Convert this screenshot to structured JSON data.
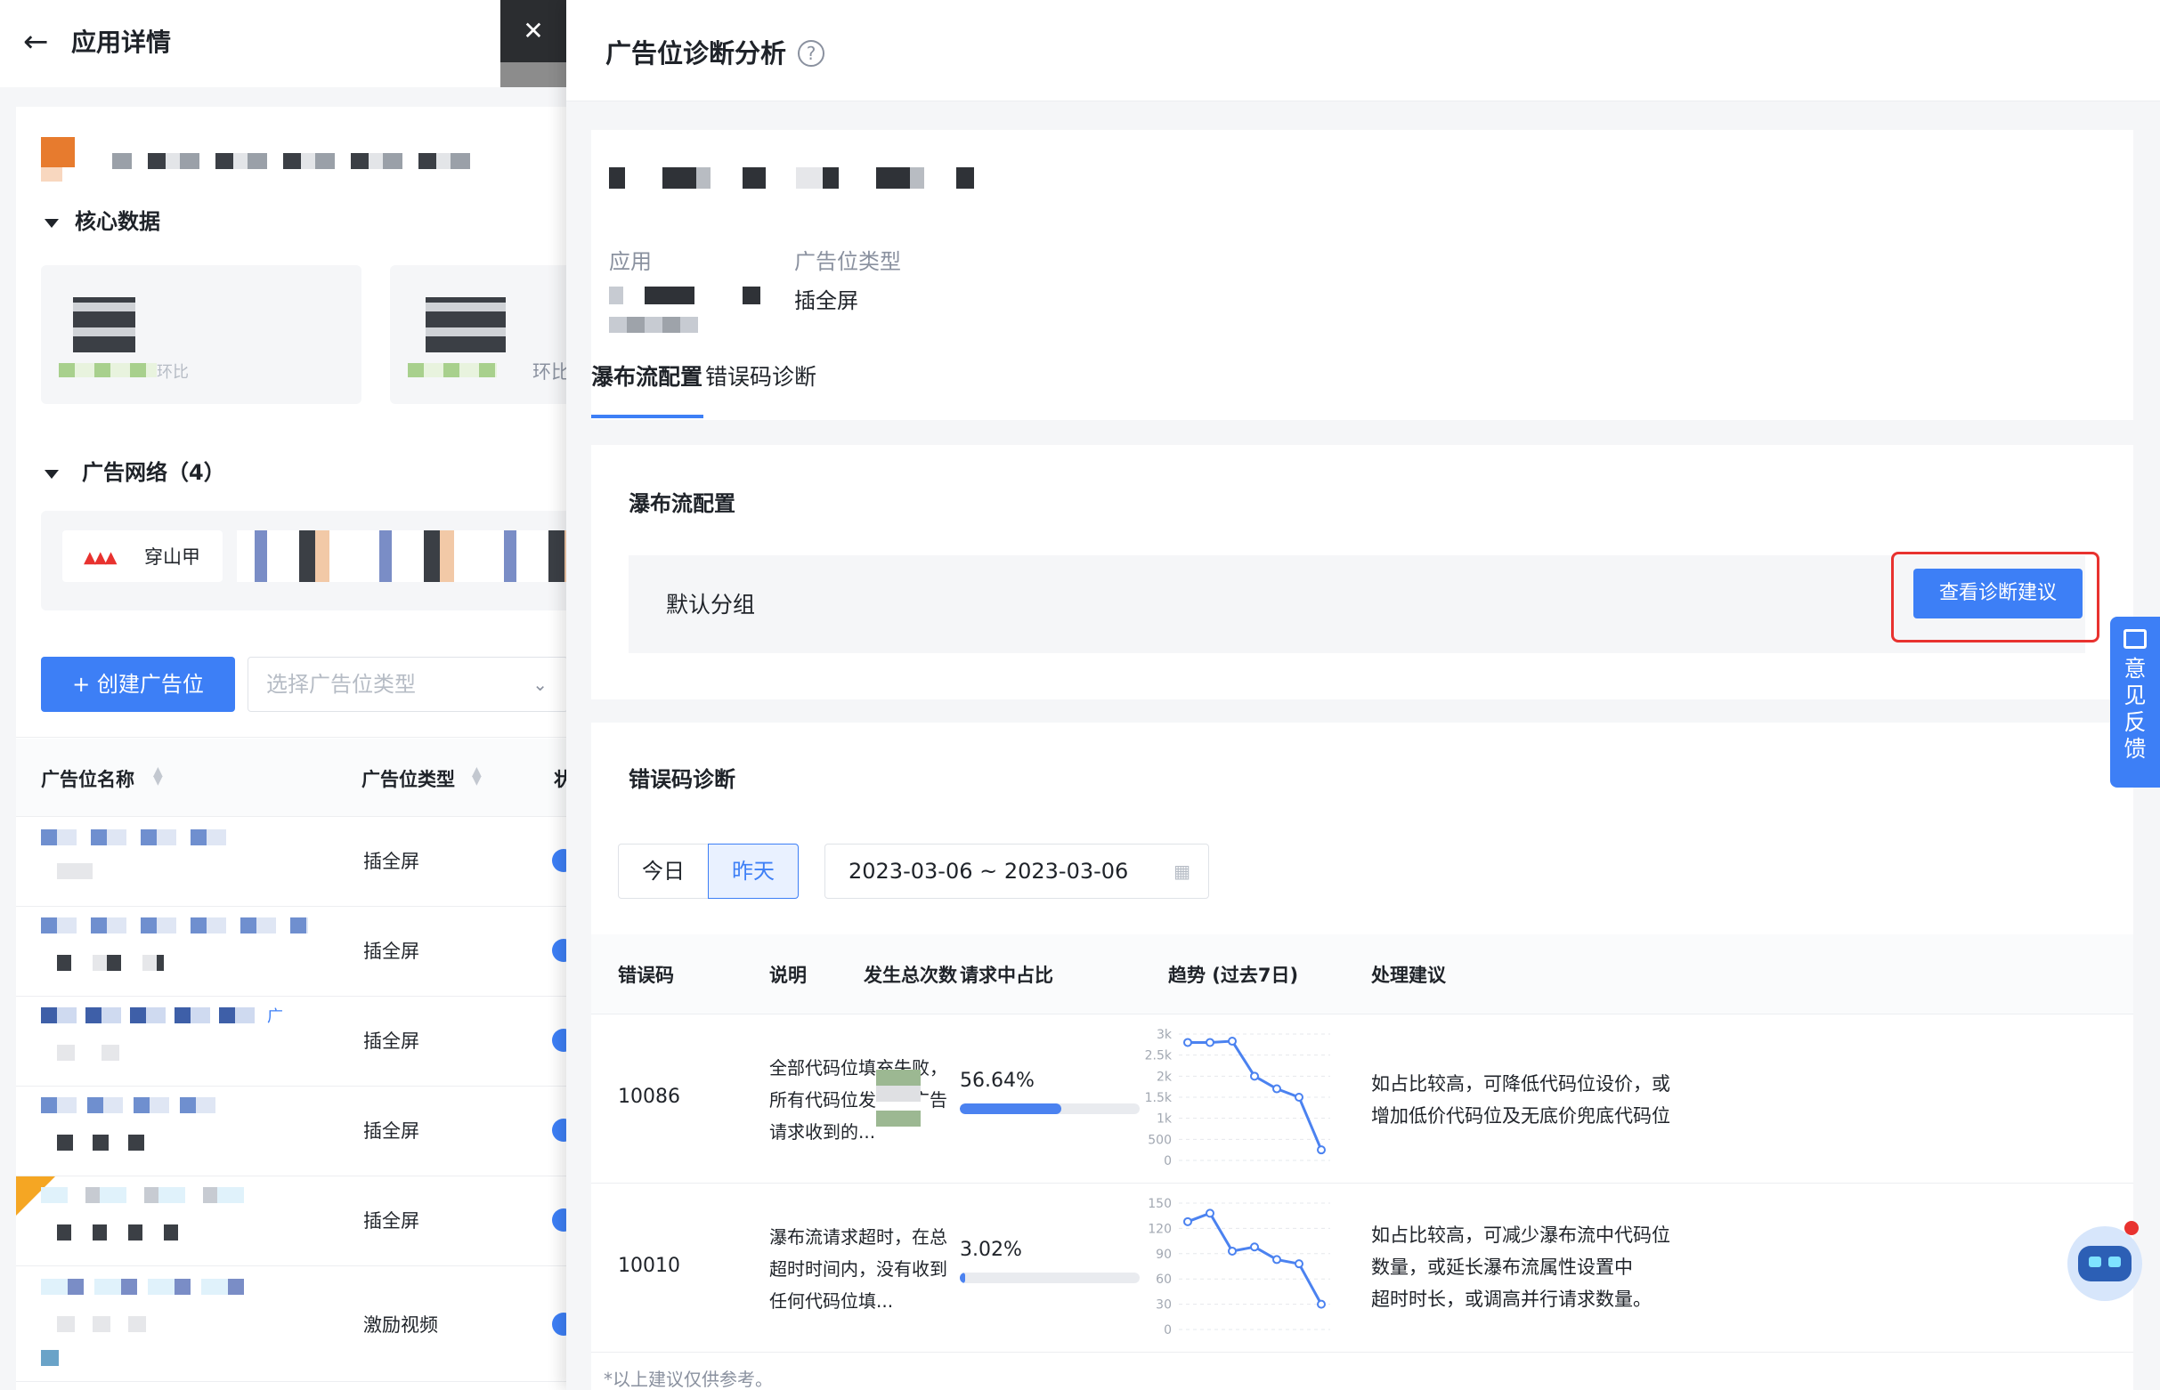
{
  "left_page": {
    "back_icon": "arrow-left-icon",
    "title": "应用详情",
    "core_data_title": "核心数据",
    "ratio_label": "环比",
    "ad_network_title": "广告网络（4）",
    "network_first": "穿山甲",
    "create_button": "+ 创建广告位",
    "select_placeholder": "选择广告位类型",
    "columns": [
      "广告位名称",
      "广告位类型",
      "状"
    ],
    "rows": [
      {
        "type": "插全屏"
      },
      {
        "type": "插全屏"
      },
      {
        "type": "插全屏"
      },
      {
        "type": "插全屏"
      },
      {
        "type": "插全屏"
      },
      {
        "type": "激励视频"
      }
    ],
    "row_fragment": "广"
  },
  "drawer": {
    "close_icon": "close-icon",
    "title": "广告位诊断分析",
    "info": {
      "app_label": "应用",
      "type_label": "广告位类型",
      "type_value": "插全屏"
    },
    "tabs": [
      "瀑布流配置",
      "错误码诊断"
    ],
    "waterfall": {
      "title": "瀑布流配置",
      "group_name": "默认分组",
      "button": "查看诊断建议"
    },
    "error_diag": {
      "title": "错误码诊断",
      "today": "今日",
      "yesterday": "昨天",
      "date_range": "2023-03-06 ~ 2023-03-06",
      "columns": [
        "错误码",
        "说明",
        "发生总次数",
        "请求中占比",
        "趋势 (过去7日)",
        "处理建议"
      ],
      "rows": [
        {
          "code": "10086",
          "desc": "全部代码位填充失败，所有代码位发起的广告请求收到的...",
          "pct": "56.64%",
          "pct_value": 56.64,
          "trend_ticks": [
            "3k",
            "2.5k",
            "2k",
            "1.5k",
            "1k",
            "500",
            "0"
          ],
          "trend": [
            2800,
            2800,
            2830,
            2000,
            1700,
            1500,
            250
          ],
          "trend_max": 3000,
          "advice_l1": "如占比较高，可降低代码位设价，或",
          "advice_l2": "增加低价代码位及无底价兜底代码位"
        },
        {
          "code": "10010",
          "desc": "瀑布流请求超时，在总超时时间内，没有收到任何代码位填...",
          "pct": "3.02%",
          "pct_value": 3.02,
          "trend_ticks": [
            "150",
            "120",
            "90",
            "60",
            "30",
            "0"
          ],
          "trend": [
            128,
            138,
            93,
            98,
            83,
            78,
            30
          ],
          "trend_max": 150,
          "advice_l1": "如占比较高，可减少瀑布流中代码位",
          "advice_l2": "数量，或延长瀑布流属性设置中",
          "advice_l3": "超时时长，或调高并行请求数量。"
        }
      ],
      "footnote": "*以上建议仅供参考。"
    }
  },
  "feedback": "意见反馈",
  "colors": {
    "primary": "#3d7ff6",
    "highlight": "#e8322f",
    "trend": "#4b82f0"
  }
}
